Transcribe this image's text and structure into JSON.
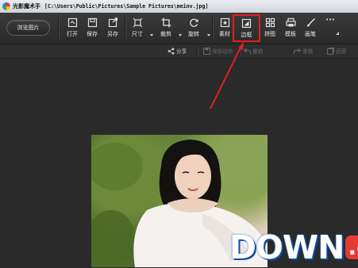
{
  "window": {
    "app_name": "光影魔术手",
    "file_path": "[C:\\Users\\Public\\Pictures\\Sample Pictures\\meinv.jpg]"
  },
  "toolbar": {
    "browse_label": "浏览图片",
    "tools": [
      {
        "label": "打开",
        "icon": "open-icon"
      },
      {
        "label": "保存",
        "icon": "save-icon"
      },
      {
        "label": "另存",
        "icon": "save-as-icon"
      },
      {
        "label": "尺寸",
        "icon": "resize-icon"
      },
      {
        "label": "裁剪",
        "icon": "crop-icon"
      },
      {
        "label": "旋转",
        "icon": "rotate-icon"
      },
      {
        "label": "素材",
        "icon": "material-icon"
      },
      {
        "label": "边框",
        "icon": "border-icon"
      },
      {
        "label": "拼图",
        "icon": "collage-icon"
      },
      {
        "label": "模板",
        "icon": "template-icon"
      },
      {
        "label": "画笔",
        "icon": "brush-icon"
      }
    ],
    "more_label": "···"
  },
  "subbar": {
    "share": "分享",
    "save_all": "保存动作",
    "undo": "撤销",
    "redo": "重做",
    "restore": "还原"
  },
  "watermark": {
    "main": "DOWN",
    "suffix": ".cc"
  },
  "colors": {
    "highlight": "#e02020",
    "annotation_arrow": "#e02020",
    "toolbar_bg": "#2f2f2f",
    "canvas_bg": "#2a2a2a"
  }
}
